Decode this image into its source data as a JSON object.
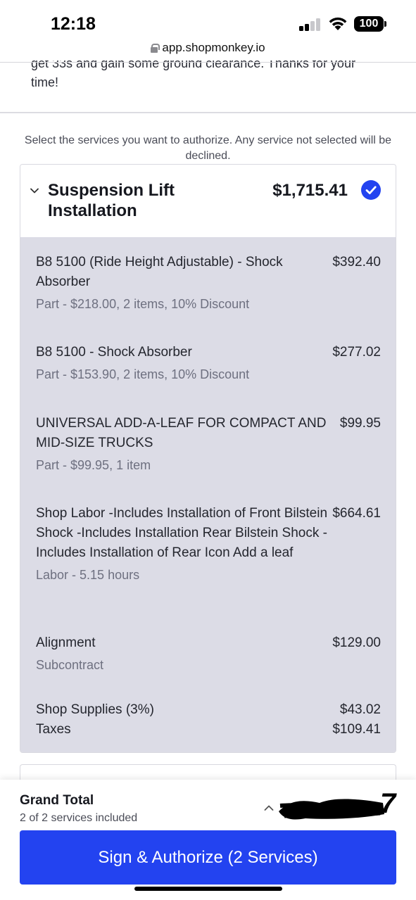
{
  "status_bar": {
    "time": "12:18",
    "battery": "100"
  },
  "browser": {
    "url": "app.shopmonkey.io"
  },
  "message": {
    "partial_line": "get 33s and gain some ground clearance. Thanks for your",
    "end_line": "time!"
  },
  "instructions": "Select the services you want to authorize. Any service not selected will be declined.",
  "service": {
    "title": "Suspension Lift Installation",
    "price": "$1,715.41",
    "items": [
      {
        "description": "B8 5100 (Ride Height Adjustable) - Shock Absorber",
        "detail": "Part - $218.00, 2 items, 10% Discount",
        "price": "$392.40"
      },
      {
        "description": "B8 5100 - Shock Absorber",
        "detail": "Part - $153.90, 2 items, 10% Discount",
        "price": "$277.02"
      },
      {
        "description": "UNIVERSAL ADD-A-LEAF FOR COMPACT AND MID-SIZE TRUCKS",
        "detail": "Part - $99.95, 1 item",
        "price": "$99.95"
      },
      {
        "description": "Shop Labor -Includes Installation of Front Bilstein Shock -Includes Installation Rear Bilstein Shock -Includes Installation of Rear Icon Add a leaf",
        "detail": "Labor - 5.15 hours",
        "price": "$664.61"
      },
      {
        "description": "Alignment",
        "detail": "Subcontract",
        "price": "$129.00"
      }
    ],
    "supplies": {
      "label": "Shop Supplies (3%)",
      "price": "$43.02"
    },
    "taxes": {
      "label": "Taxes",
      "price": "$109.41"
    }
  },
  "footer": {
    "grand_total_label": "Grand Total",
    "services_included": "2 of 2 services included",
    "grand_total_value_visible": "7",
    "button_label": "Sign & Authorize (2 Services)"
  },
  "colors": {
    "accent": "#2343f0",
    "items_bg": "#dcdce6"
  }
}
